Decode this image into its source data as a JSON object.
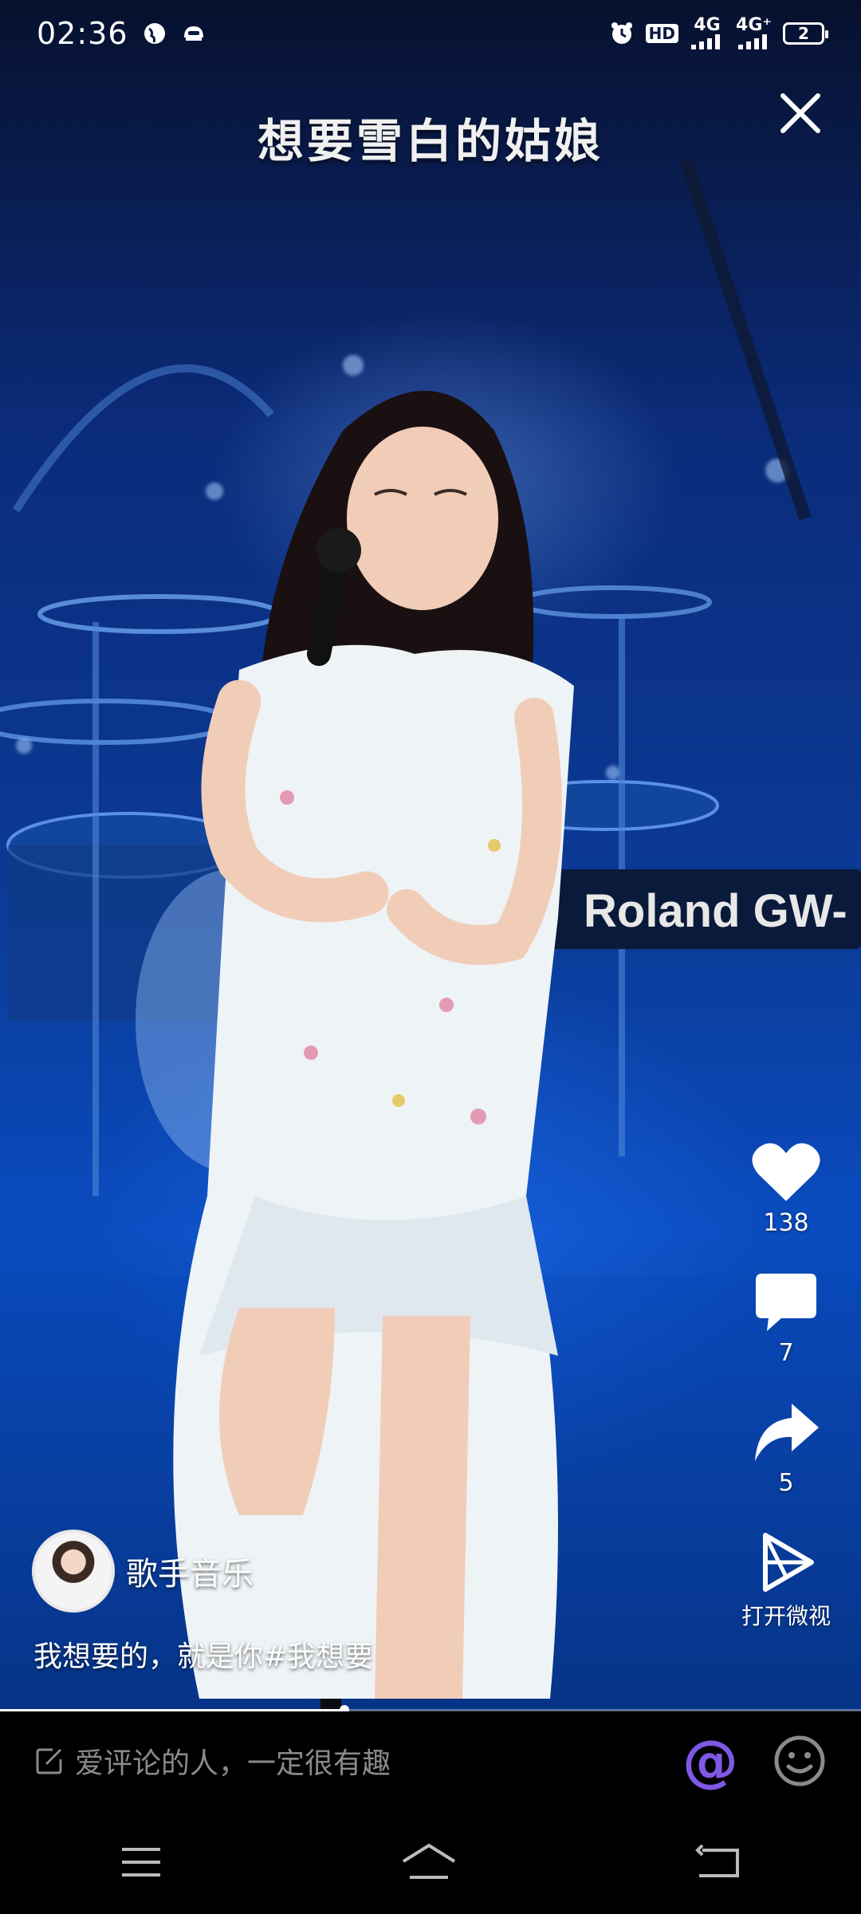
{
  "status_bar": {
    "time": "02:36",
    "network1": "4G",
    "network2": "4G⁺",
    "battery": "2",
    "hd_label": "HD"
  },
  "video": {
    "lyric": "想要雪白的姑娘",
    "keyboard_brand": "Roland GW-"
  },
  "actions": {
    "like_count": "138",
    "comment_count": "7",
    "share_count": "5",
    "open_app_label": "打开微视"
  },
  "author": {
    "name": "歌手音乐"
  },
  "caption": "我想要的，就是你#我想要",
  "playback": {
    "progress": 0.4
  },
  "comment_bar": {
    "placeholder": "爱评论的人，一定很有趣",
    "at_symbol": "@"
  }
}
